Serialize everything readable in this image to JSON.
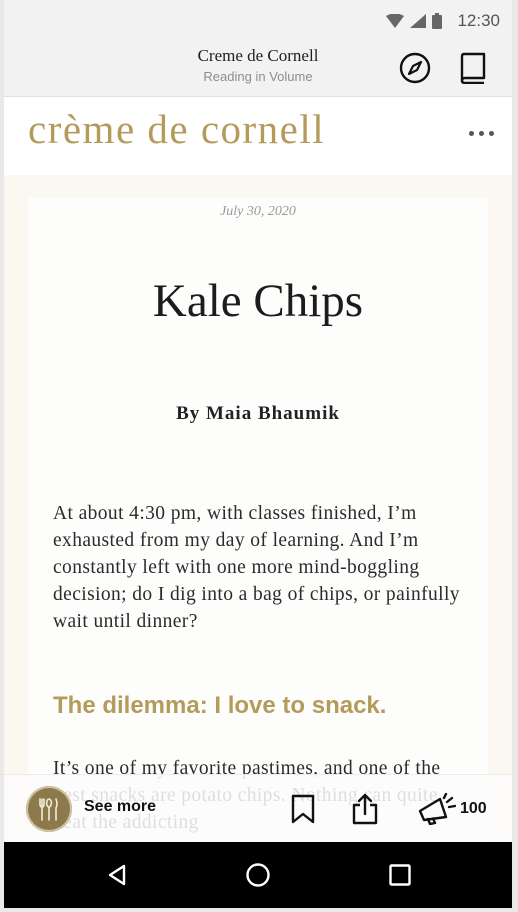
{
  "status_bar": {
    "time": "12:30"
  },
  "app_bar": {
    "title": "Creme de Cornell",
    "subtitle": "Reading in Volume"
  },
  "publication": {
    "logo_text": "crème de cornell"
  },
  "article": {
    "date": "July 30, 2020",
    "headline": "Kale Chips",
    "byline": "By Maia Bhaumik",
    "paragraph_1": "At about 4:30 pm, with classes finished, I’m exhausted from my day of learning. And I’m constantly left with one more mind-boggling decision; do I dig into a bag of chips, or painfully wait until dinner?",
    "subheading": "The dilemma: I love to snack.",
    "paragraph_2": "It’s one of my favorite pastimes, and one of the best snacks are potato chips. Nothing can quite beat the addicting"
  },
  "action_bar": {
    "see_more_label": "See more",
    "cheer_count": "100"
  },
  "colors": {
    "brand_gold": "#b59b5b",
    "background": "#fbf8f1"
  }
}
